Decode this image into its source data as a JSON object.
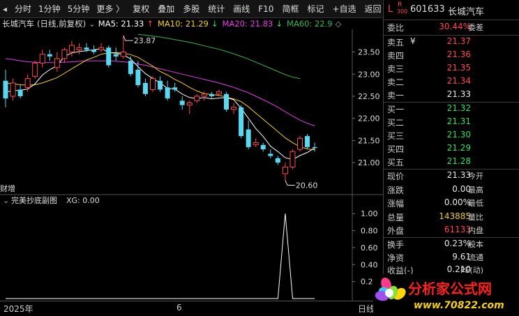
{
  "toolbar": {
    "items": [
      "分时",
      "1分钟",
      "5分钟",
      "更多",
      "复权",
      "叠加",
      "多股",
      "统计",
      "画线",
      "F10",
      "简框",
      "标记",
      "+自选",
      "返回"
    ],
    "more_chevron": "〉"
  },
  "chart": {
    "stock_name": "长城汽车",
    "period": "(日线,前复权)",
    "ma5_label": "MA5: 21.33",
    "ma10_label": "MA10: 21.29",
    "ma20_label": "MA20: 21.83",
    "ma60_label": "MA60: 22.9",
    "high_annot": "23.87",
    "low_annot": "20.60",
    "side_label": "财增",
    "colors": {
      "ma5": "#ffffff",
      "ma10": "#f5d020",
      "ma20": "#e040e0",
      "ma60": "#3ab54a",
      "up": "#ff4a4a",
      "down": "#5ad8f0"
    },
    "price_axis": [
      "23.50",
      "23.00",
      "22.50",
      "22.00",
      "21.50",
      "21.00"
    ],
    "ylim": [
      20.45,
      23.95
    ],
    "candles": [
      {
        "o": 22.85,
        "h": 23.1,
        "l": 22.25,
        "c": 22.45
      },
      {
        "o": 22.5,
        "h": 22.9,
        "l": 22.4,
        "c": 22.8
      },
      {
        "o": 22.65,
        "h": 22.75,
        "l": 22.45,
        "c": 22.5
      },
      {
        "o": 22.7,
        "h": 23.0,
        "l": 22.6,
        "c": 22.9
      },
      {
        "o": 22.95,
        "h": 23.3,
        "l": 22.9,
        "c": 23.25
      },
      {
        "o": 23.25,
        "h": 23.55,
        "l": 23.15,
        "c": 23.45
      },
      {
        "o": 23.45,
        "h": 23.55,
        "l": 23.3,
        "c": 23.4
      },
      {
        "o": 23.15,
        "h": 23.5,
        "l": 23.05,
        "c": 23.35
      },
      {
        "o": 23.35,
        "h": 23.6,
        "l": 23.25,
        "c": 23.55
      },
      {
        "o": 23.5,
        "h": 23.75,
        "l": 23.4,
        "c": 23.65
      },
      {
        "o": 23.55,
        "h": 23.7,
        "l": 23.45,
        "c": 23.6
      },
      {
        "o": 23.6,
        "h": 23.7,
        "l": 23.5,
        "c": 23.55
      },
      {
        "o": 23.55,
        "h": 23.65,
        "l": 23.45,
        "c": 23.5
      },
      {
        "o": 23.55,
        "h": 23.7,
        "l": 23.5,
        "c": 23.6
      },
      {
        "o": 23.6,
        "h": 23.65,
        "l": 23.15,
        "c": 23.2
      },
      {
        "o": 23.45,
        "h": 23.6,
        "l": 23.3,
        "c": 23.4
      },
      {
        "o": 23.4,
        "h": 23.87,
        "l": 23.35,
        "c": 23.5
      },
      {
        "o": 23.3,
        "h": 23.4,
        "l": 22.95,
        "c": 23.0
      },
      {
        "o": 23.1,
        "h": 23.3,
        "l": 22.7,
        "c": 22.75
      },
      {
        "o": 22.8,
        "h": 22.9,
        "l": 22.5,
        "c": 22.55
      },
      {
        "o": 22.65,
        "h": 22.95,
        "l": 22.6,
        "c": 22.9
      },
      {
        "o": 22.85,
        "h": 22.95,
        "l": 22.6,
        "c": 22.65
      },
      {
        "o": 22.7,
        "h": 22.85,
        "l": 22.4,
        "c": 22.45
      },
      {
        "o": 22.7,
        "h": 22.8,
        "l": 22.6,
        "c": 22.65
      },
      {
        "o": 22.4,
        "h": 22.5,
        "l": 22.2,
        "c": 22.3
      },
      {
        "o": 22.3,
        "h": 22.4,
        "l": 22.1,
        "c": 22.35
      },
      {
        "o": 22.4,
        "h": 22.55,
        "l": 22.35,
        "c": 22.5
      },
      {
        "o": 22.5,
        "h": 22.6,
        "l": 22.4,
        "c": 22.55
      },
      {
        "o": 22.55,
        "h": 22.6,
        "l": 22.45,
        "c": 22.5
      },
      {
        "o": 22.55,
        "h": 22.65,
        "l": 22.5,
        "c": 22.6
      },
      {
        "o": 22.55,
        "h": 22.6,
        "l": 22.15,
        "c": 22.2
      },
      {
        "o": 22.2,
        "h": 22.35,
        "l": 22.1,
        "c": 22.25
      },
      {
        "o": 22.25,
        "h": 22.3,
        "l": 21.55,
        "c": 21.6
      },
      {
        "o": 21.75,
        "h": 21.95,
        "l": 21.3,
        "c": 21.35
      },
      {
        "o": 21.4,
        "h": 21.55,
        "l": 21.35,
        "c": 21.45
      },
      {
        "o": 21.4,
        "h": 21.45,
        "l": 21.25,
        "c": 21.3
      },
      {
        "o": 21.2,
        "h": 21.3,
        "l": 21.1,
        "c": 21.15
      },
      {
        "o": 21.1,
        "h": 21.15,
        "l": 20.95,
        "c": 21.0
      },
      {
        "o": 20.75,
        "h": 21.0,
        "l": 20.6,
        "c": 20.9
      },
      {
        "o": 20.9,
        "h": 21.3,
        "l": 20.85,
        "c": 21.25
      },
      {
        "o": 21.3,
        "h": 21.6,
        "l": 21.25,
        "c": 21.55
      },
      {
        "o": 21.6,
        "h": 21.65,
        "l": 21.3,
        "c": 21.35
      },
      {
        "o": 21.35,
        "h": 21.45,
        "l": 21.25,
        "c": 21.33
      }
    ],
    "ma5": [
      22.6,
      22.62,
      22.64,
      22.66,
      22.78,
      22.98,
      23.1,
      23.19,
      23.4,
      23.48,
      23.51,
      23.53,
      23.55,
      23.58,
      23.49,
      23.47,
      23.44,
      23.34,
      23.17,
      23.01,
      22.9,
      22.8,
      22.68,
      22.66,
      22.55,
      22.47,
      22.45,
      22.47,
      22.44,
      22.46,
      22.47,
      22.42,
      22.23,
      22.0,
      21.77,
      21.59,
      21.37,
      21.25,
      21.11,
      21.07,
      21.16,
      21.23,
      21.33
    ],
    "ma10": [
      22.8,
      22.78,
      22.76,
      22.75,
      22.76,
      22.8,
      22.86,
      22.92,
      23.02,
      23.12,
      23.22,
      23.32,
      23.38,
      23.45,
      23.48,
      23.49,
      23.47,
      23.44,
      23.38,
      23.28,
      23.18,
      23.06,
      22.98,
      22.88,
      22.8,
      22.7,
      22.62,
      22.56,
      22.54,
      22.52,
      22.48,
      22.44,
      22.38,
      22.26,
      22.12,
      21.98,
      21.84,
      21.7,
      21.56,
      21.45,
      21.36,
      21.31,
      21.29
    ],
    "ma20": [
      23.35,
      23.33,
      23.3,
      23.28,
      23.27,
      23.26,
      23.26,
      23.26,
      23.27,
      23.28,
      23.29,
      23.3,
      23.3,
      23.3,
      23.3,
      23.29,
      23.28,
      23.26,
      23.23,
      23.2,
      23.16,
      23.12,
      23.08,
      23.04,
      23.0,
      22.96,
      22.92,
      22.88,
      22.84,
      22.8,
      22.75,
      22.7,
      22.64,
      22.58,
      22.5,
      22.42,
      22.34,
      22.25,
      22.15,
      22.05,
      21.96,
      21.89,
      21.83
    ],
    "ma60_start": 18,
    "ma60": [
      23.9,
      23.88,
      23.86,
      23.84,
      23.81,
      23.78,
      23.75,
      23.72,
      23.68,
      23.64,
      23.6,
      23.56,
      23.51,
      23.46,
      23.4,
      23.34,
      23.27,
      23.2,
      23.13,
      23.06,
      22.99,
      22.93,
      22.9
    ],
    "sub_title": "完美抄底副图",
    "sub_xg_label": "XG: 0.00",
    "sub_axis": [
      "1.00",
      "0.80",
      "0.60",
      "0.40",
      "0.20"
    ],
    "sub_ylim": [
      0,
      1.1
    ],
    "xg_values": [
      0,
      0,
      0,
      0,
      0,
      0,
      0,
      0,
      0,
      0,
      0,
      0,
      0,
      0,
      0,
      0,
      0,
      0,
      0,
      0,
      0,
      0,
      0,
      0,
      0,
      0,
      0,
      0,
      0,
      0,
      0,
      0,
      0,
      0,
      0,
      0,
      0,
      0,
      1,
      0,
      0,
      0,
      0
    ]
  },
  "time_axis": {
    "year_label": "2025年",
    "month_label": "6",
    "right_label": "日线"
  },
  "quote": {
    "l_badge": "L",
    "r_badge": "R",
    "r_sub": "300",
    "code": "601633",
    "name": "长城汽车",
    "weibi_label": "委比",
    "weibi_value": "30.44%",
    "weicha_label": "委差",
    "sells": [
      {
        "label": "卖五",
        "price": "21.37",
        "mark": "¥"
      },
      {
        "label": "卖四",
        "price": "21.36"
      },
      {
        "label": "卖三",
        "price": "21.35"
      },
      {
        "label": "卖二",
        "price": "21.34"
      },
      {
        "label": "卖一",
        "price": "21.33"
      }
    ],
    "buys": [
      {
        "label": "买一",
        "price": "21.32"
      },
      {
        "label": "买二",
        "price": "21.31"
      },
      {
        "label": "买三",
        "price": "21.30"
      },
      {
        "label": "买四",
        "price": "21.29"
      },
      {
        "label": "买五",
        "price": "21.28"
      }
    ],
    "stats": [
      {
        "label": "现价",
        "value": "21.33",
        "label2": "今开",
        "color": "white"
      },
      {
        "label": "涨跌",
        "value": "0.00",
        "label2": "最高",
        "color": "white"
      },
      {
        "label": "涨幅",
        "value": "0.00%",
        "label2": "最低",
        "color": "white"
      },
      {
        "label": "总量",
        "value": "143885",
        "label2": "量比",
        "color": "yellow"
      },
      {
        "label": "外盘",
        "value": "61133",
        "label2": "内盘",
        "color": "red"
      }
    ],
    "stats2": [
      {
        "label": "换手",
        "value": "0.23%",
        "label2": "股本"
      },
      {
        "label": "净资",
        "value": "9.61",
        "label2": "流通"
      },
      {
        "label": "收益(-)",
        "value": "0.210",
        "label2": "PE(动)"
      }
    ]
  },
  "watermark": {
    "title": "分析家公式网",
    "url": "www.70822.com"
  }
}
